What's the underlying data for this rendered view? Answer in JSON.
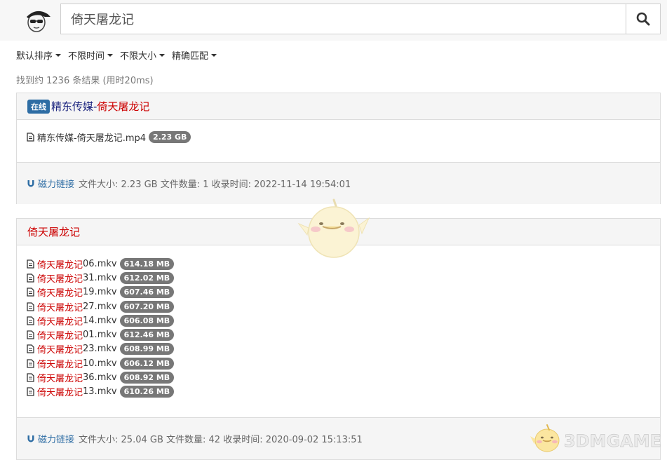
{
  "search": {
    "query": "倚天屠龙记"
  },
  "filters": [
    {
      "label": "默认排序"
    },
    {
      "label": "不限时间"
    },
    {
      "label": "不限大小"
    },
    {
      "label": "精确匹配"
    }
  ],
  "result_count": "找到约 1236 条结果 (用时20ms)",
  "results": [
    {
      "badge": "在线",
      "title_prefix": "精东传媒-",
      "title_highlight": "倚天屠龙记",
      "files": [
        {
          "name": "精东传媒-倚天屠龙记.mp4",
          "size": "2.23 GB"
        }
      ],
      "footer": {
        "magnet_label": "磁力链接",
        "info": "文件大小: 2.23 GB 文件数量: 1 收录时间: 2022-11-14 19:54:01"
      }
    },
    {
      "title_highlight": "倚天屠龙记",
      "files": [
        {
          "name_highlight": "倚天屠龙记",
          "name_rest": "06.mkv",
          "size": "614.18 MB"
        },
        {
          "name_highlight": "倚天屠龙记",
          "name_rest": "31.mkv",
          "size": "612.02 MB"
        },
        {
          "name_highlight": "倚天屠龙记",
          "name_rest": "19.mkv",
          "size": "607.46 MB"
        },
        {
          "name_highlight": "倚天屠龙记",
          "name_rest": "27.mkv",
          "size": "607.20 MB"
        },
        {
          "name_highlight": "倚天屠龙记",
          "name_rest": "14.mkv",
          "size": "606.08 MB"
        },
        {
          "name_highlight": "倚天屠龙记",
          "name_rest": "01.mkv",
          "size": "612.46 MB"
        },
        {
          "name_highlight": "倚天屠龙记",
          "name_rest": "23.mkv",
          "size": "608.99 MB"
        },
        {
          "name_highlight": "倚天屠龙记",
          "name_rest": "10.mkv",
          "size": "606.12 MB"
        },
        {
          "name_highlight": "倚天屠龙记",
          "name_rest": "36.mkv",
          "size": "608.92 MB"
        },
        {
          "name_highlight": "倚天屠龙记",
          "name_rest": "13.mkv",
          "size": "610.26 MB"
        }
      ],
      "footer": {
        "magnet_label": "磁力链接",
        "info": "文件大小: 25.04 GB 文件数量: 42 收录时间: 2020-09-02 15:13:51"
      }
    }
  ],
  "watermark": {
    "text": "3DMGAME"
  },
  "colors": {
    "highlight": "#cc0000",
    "title_link": "#1a237e",
    "badge_blue": "#2e6da4",
    "size_badge": "#777777",
    "panel_bg": "#f5f5f5"
  }
}
